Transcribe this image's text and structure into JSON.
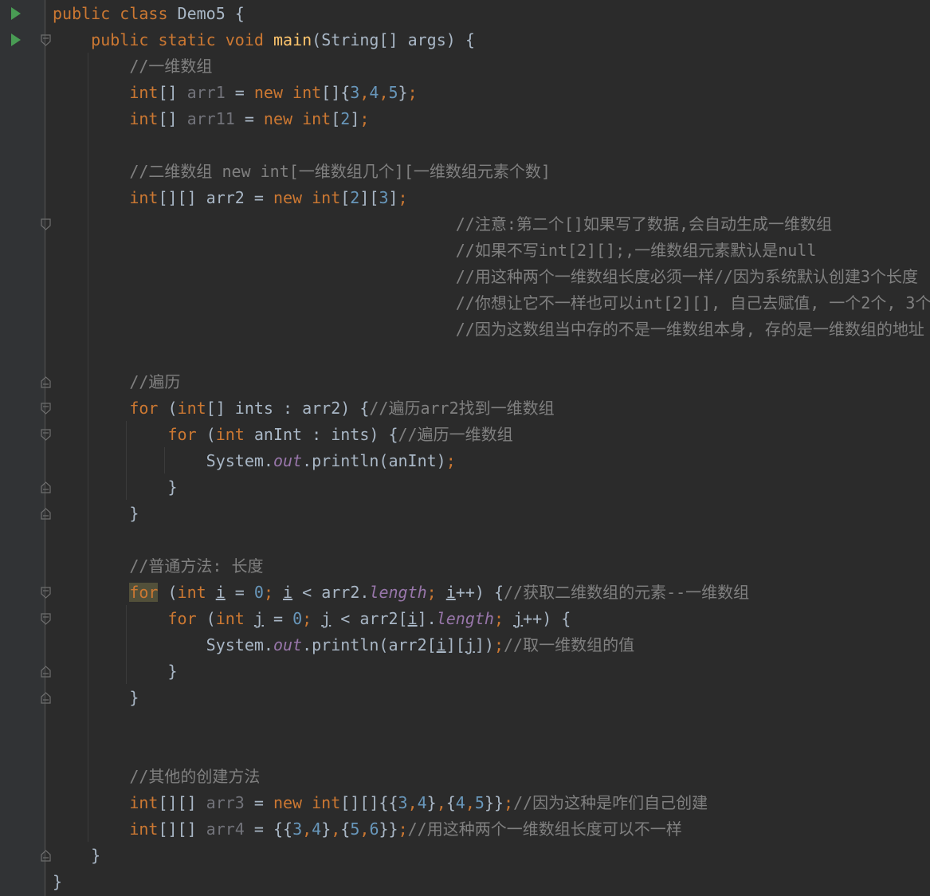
{
  "colors": {
    "background": "#2b2b2b",
    "gutter": "#313335",
    "keyword": "#cc7832",
    "method": "#ffc66d",
    "number": "#6897bb",
    "comment": "#808080",
    "field": "#9876aa",
    "text": "#a9b7c6",
    "run_icon": "#499c54"
  },
  "icons": {
    "run": "run-icon",
    "fold": "fold-icon"
  },
  "code_lines": [
    "public class Demo5 {",
    "    public static void main(String[] args) {",
    "        //一维数组",
    "        int[] arr1 = new int[]{3,4,5};",
    "        int[] arr11 = new int[2];",
    "",
    "        //二维数组 new int[一维数组几个][一维数组元素个数]",
    "        int[][] arr2 = new int[2][3];",
    "                                          //注意:第二个[]如果写了数据,会自动生成一维数组",
    "                                          //如果不写int[2][];,一维数组元素默认是null",
    "                                          //用这种两个一维数组长度必须一样//因为系统默认创建3个长度",
    "                                          //你想让它不一样也可以int[2][], 自己去赋值, 一个2个, 3个",
    "                                          //因为这数组当中存的不是一维数组本身, 存的是一维数组的地址",
    "",
    "        //遍历",
    "        for (int[] ints : arr2) {//遍历arr2找到一维数组",
    "            for (int anInt : ints) {//遍历一维数组",
    "                System.out.println(anInt);",
    "            }",
    "        }",
    "",
    "        //普通方法: 长度",
    "        for (int i = 0; i < arr2.length; i++) {//获取二维数组的元素--一维数组",
    "            for (int j = 0; j < arr2[i].length; j++) {",
    "                System.out.println(arr2[i][j]);//取一维数组的值",
    "            }",
    "        }",
    "",
    "",
    "        //其他的创建方法",
    "        int[][] arr3 = new int[][]{{3,4},{4,5}};//因为这种是咋们自己创建",
    "        int[][] arr4 = {{3,4},{5,6}};//用这种两个一维数组长度可以不一样",
    "    }",
    "}"
  ]
}
